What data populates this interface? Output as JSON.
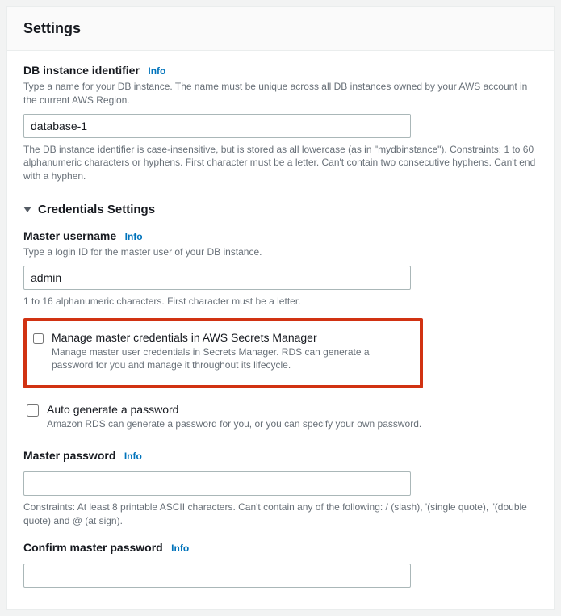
{
  "header": {
    "title": "Settings"
  },
  "dbid": {
    "label": "DB instance identifier",
    "info": "Info",
    "help": "Type a name for your DB instance. The name must be unique across all DB instances owned by your AWS account in the current AWS Region.",
    "value": "database-1",
    "constraints": "The DB instance identifier is case-insensitive, but is stored as all lowercase (as in \"mydbinstance\"). Constraints: 1 to 60 alphanumeric characters or hyphens. First character must be a letter. Can't contain two consecutive hyphens. Can't end with a hyphen."
  },
  "credSection": {
    "title": "Credentials Settings"
  },
  "username": {
    "label": "Master username",
    "info": "Info",
    "help": "Type a login ID for the master user of your DB instance.",
    "value": "admin",
    "constraints": "1 to 16 alphanumeric characters. First character must be a letter."
  },
  "secrets": {
    "title": "Manage master credentials in AWS Secrets Manager",
    "desc": "Manage master user credentials in Secrets Manager. RDS can generate a password for you and manage it throughout its lifecycle."
  },
  "autogen": {
    "title": "Auto generate a password",
    "desc": "Amazon RDS can generate a password for you, or you can specify your own password."
  },
  "password": {
    "label": "Master password",
    "info": "Info",
    "value": "",
    "constraints": "Constraints: At least 8 printable ASCII characters. Can't contain any of the following: / (slash), '(single quote), \"(double quote) and @ (at sign)."
  },
  "confirm": {
    "label": "Confirm master password",
    "info": "Info",
    "value": ""
  }
}
